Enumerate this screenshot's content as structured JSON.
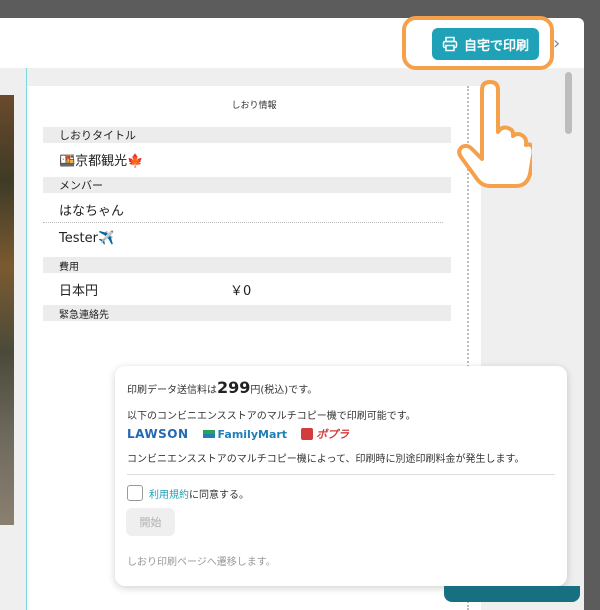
{
  "toolbar": {
    "print_button_label": "自宅で印刷",
    "print_icon": "printer-icon",
    "next_icon": "chevron-right-icon"
  },
  "page": {
    "title": "しおり情報",
    "sections": {
      "shiori_title_header": "しおりタイトル",
      "shiori_title_value": "🍱京都観光🍁",
      "members_header": "メンバー",
      "member_1": "はなちゃん",
      "member_2": "Tester✈️",
      "cost_header": "費用",
      "currency_label": "日本円",
      "cost_value": "￥0",
      "emergency_header": "緊急連絡先"
    }
  },
  "popup": {
    "fee_prefix": "印刷データ送信料は",
    "fee_amount": "299",
    "fee_suffix": "円(税込)です。",
    "available_text": "以下のコンビニエンスストアのマルチコピー機で印刷可能です。",
    "stores": [
      "LAWSON",
      "FamilyMart",
      "ポプラ"
    ],
    "extra_fee_note": "コンビニエンスストアのマルチコピー機によって、印刷時に別途印刷料金が発生します。",
    "terms_link": "利用規約",
    "agree_suffix": "に同意する。",
    "start_button": "開始",
    "navigate_note": "しおり印刷ページへ遷移します。"
  },
  "colors": {
    "accent": "#1fa2b8",
    "highlight_ring": "#f5a04a"
  }
}
